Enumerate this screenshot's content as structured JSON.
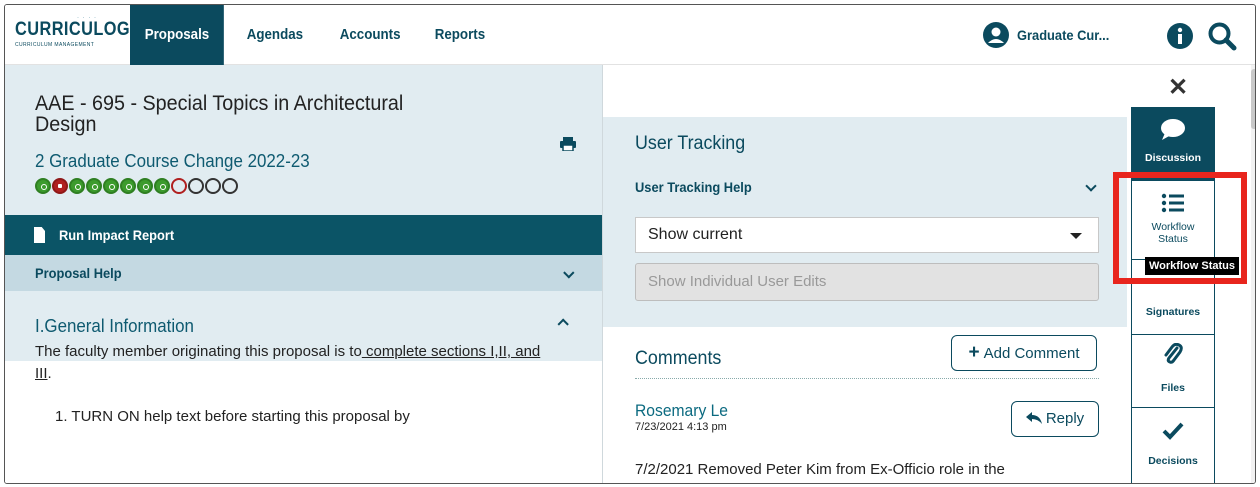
{
  "nav": {
    "logo_text": "CURRICULOG",
    "logo_sub": "CURRICULUM MANAGEMENT",
    "links": [
      "Proposals",
      "Agendas",
      "Accounts",
      "Reports"
    ],
    "user_name": "Graduate Cur..."
  },
  "proposal": {
    "title": "AAE - 695 - Special Topics in Architectural Design",
    "subtitle": "2 Graduate Course Change 2022-23",
    "status_steps": [
      "approved",
      "rejected",
      "approved",
      "approved",
      "approved",
      "approved",
      "approved",
      "approved",
      "pending-returned",
      "empty",
      "empty",
      "empty"
    ]
  },
  "left": {
    "impact_report": "Run Impact Report",
    "proposal_help": "Proposal Help",
    "section_title": "I.General Information",
    "body_text_prefix": "The faculty member originating this proposal is to",
    "body_link": " complete sections I,II, and III",
    "body_text_suffix": ".",
    "list_item": "1. TURN ON help text before starting this proposal by"
  },
  "tracking": {
    "title": "User Tracking",
    "help": "User Tracking Help",
    "select_value": "Show current",
    "individual_edits": "Show Individual User Edits"
  },
  "comments": {
    "title": "Comments",
    "add_label": "Add Comment",
    "author": "Rosemary Le",
    "date": "7/23/2021 4:13 pm",
    "reply_label": "Reply",
    "text": "7/2/2021 Removed Peter Kim from Ex-Officio role in the"
  },
  "sidebar": {
    "discussion": "Discussion",
    "workflow_line1": "Workflow",
    "workflow_line2": "Status",
    "signatures": "Signatures",
    "files": "Files",
    "decisions": "Decisions",
    "tooltip": "Workflow Status"
  },
  "colors": {
    "brand": "#0b4a5e",
    "panel": "#e1ecf1",
    "highlight": "#e8251d",
    "approved": "#3c9b2d",
    "rejected": "#b02020"
  }
}
